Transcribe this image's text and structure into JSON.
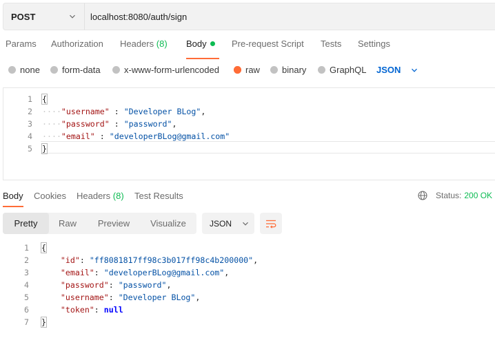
{
  "request": {
    "method": "POST",
    "url": "localhost:8080/auth/sign"
  },
  "request_tabs": [
    {
      "label": "Params"
    },
    {
      "label": "Authorization"
    },
    {
      "label": "Headers",
      "count": "(8)"
    },
    {
      "label": "Body",
      "active": true
    },
    {
      "label": "Pre-request Script"
    },
    {
      "label": "Tests"
    },
    {
      "label": "Settings"
    }
  ],
  "body_types": [
    {
      "label": "none"
    },
    {
      "label": "form-data"
    },
    {
      "label": "x-www-form-urlencoded"
    },
    {
      "label": "raw",
      "selected": true
    },
    {
      "label": "binary"
    },
    {
      "label": "GraphQL"
    }
  ],
  "body_format": "JSON",
  "request_body": {
    "line_numbers": [
      "1",
      "2",
      "3",
      "4",
      "5"
    ],
    "open_brace": "{",
    "close_brace": "}",
    "fields": [
      {
        "key": "\"username\"",
        "sep": " : ",
        "value": "\"Developer BLog\"",
        "tail": ","
      },
      {
        "key": "\"password\"",
        "sep": " : ",
        "value": "\"password\"",
        "tail": ","
      },
      {
        "key": "\"email\"",
        "sep": " : ",
        "value": "\"developerBLog@gmail.com\"",
        "tail": ""
      }
    ]
  },
  "response_tabs": [
    {
      "label": "Body",
      "active": true
    },
    {
      "label": "Cookies"
    },
    {
      "label": "Headers",
      "count": "(8)"
    },
    {
      "label": "Test Results"
    }
  ],
  "status": {
    "label": "Status:",
    "value": "200 OK"
  },
  "view_modes": [
    {
      "label": "Pretty",
      "active": true
    },
    {
      "label": "Raw"
    },
    {
      "label": "Preview"
    },
    {
      "label": "Visualize"
    }
  ],
  "response_format": "JSON",
  "response_body": {
    "line_numbers": [
      "1",
      "2",
      "3",
      "4",
      "5",
      "6",
      "7"
    ],
    "open_brace": "{",
    "close_brace": "}",
    "fields": [
      {
        "key": "\"id\"",
        "sep": ": ",
        "value": "\"ff8081817ff98c3b017ff98c4b200000\"",
        "tail": ","
      },
      {
        "key": "\"email\"",
        "sep": ": ",
        "value": "\"developerBLog@gmail.com\"",
        "tail": ","
      },
      {
        "key": "\"password\"",
        "sep": ": ",
        "value": "\"password\"",
        "tail": ","
      },
      {
        "key": "\"username\"",
        "sep": ": ",
        "value": "\"Developer BLog\"",
        "tail": ","
      },
      {
        "key": "\"token\"",
        "sep": ": ",
        "value": "null",
        "tail": ""
      }
    ]
  },
  "icons": {
    "method_dropdown": "chevron-down-icon",
    "format_dropdown": "chevron-down-icon",
    "status": "globe-icon",
    "wrap": "wrap-lines-icon"
  },
  "colors": {
    "accent": "#ff6c37",
    "success": "#0cbb52",
    "link": "#0265d2",
    "json_key": "#a31515",
    "json_string": "#0451a5",
    "json_keyword": "#0000ff"
  }
}
